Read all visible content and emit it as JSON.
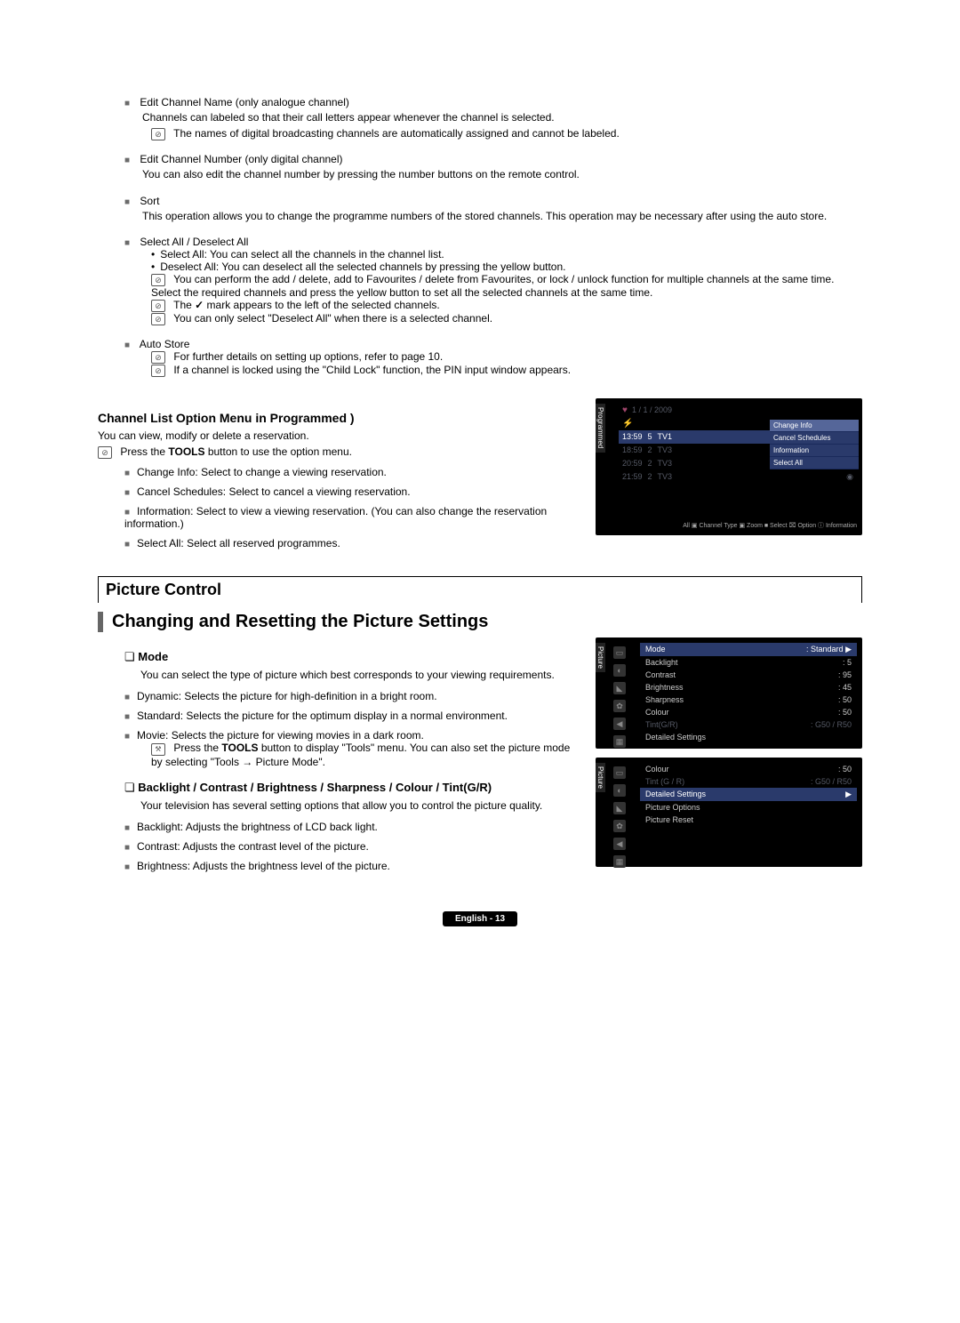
{
  "sections": {
    "editChannelName": {
      "title": "Edit Channel Name (only analogue channel)",
      "desc": "Channels can labeled so that their call letters appear whenever the channel is selected.",
      "note": "The names of digital broadcasting channels are automatically assigned and cannot be labeled."
    },
    "editChannelNumber": {
      "title": "Edit Channel Number (only digital channel)",
      "desc": "You can also edit the channel number by pressing the number buttons on the remote control."
    },
    "sort": {
      "title": "Sort",
      "desc": "This operation allows you to change the programme numbers of the stored channels. This operation may be necessary after using the auto store."
    },
    "selectAll": {
      "title": "Select All / Deselect All",
      "b1": "Select All: You can select all the channels in the channel list.",
      "b2": "Deselect All: You can deselect all the selected channels by pressing the yellow button.",
      "n1": "You can perform the add / delete, add to Favourites / delete from Favourites, or lock / unlock function for multiple channels at the same time. Select the required channels and press the yellow button to set all the selected channels at the same time.",
      "n2a": "The ",
      "n2b": " mark appears to the left of the selected channels.",
      "n3": "You can only select \"Deselect All\" when there is a selected channel."
    },
    "autoStore": {
      "title": "Auto Store",
      "n1": "For further details on setting up options, refer to page 10.",
      "n2": "If a channel is locked using the \"Child Lock\" function, the PIN input window appears."
    },
    "programmed": {
      "heading": "Channel List Option Menu in Programmed )",
      "desc": "You can view, modify or delete a reservation.",
      "note_pre": "Press the ",
      "note_bold": "TOOLS",
      "note_post": " button to use the option menu.",
      "b1": "Change Info: Select to change a viewing reservation.",
      "b2": "Cancel Schedules: Select to cancel a viewing reservation.",
      "b3": "Information: Select to view a viewing reservation. (You can also change the reservation information.)",
      "b4": "Select All: Select all reserved programmes."
    },
    "pictureBand": "Picture Control",
    "pictureTitle": "Changing and Resetting the Picture Settings",
    "mode": {
      "title": "Mode",
      "desc": "You can select the type of picture which best corresponds to your viewing requirements.",
      "b1": "Dynamic: Selects the picture for high-definition in a bright room.",
      "b2": "Standard: Selects the picture for the optimum display in a normal environment.",
      "b3": "Movie: Selects the picture for viewing movies in a dark room.",
      "tool_pre": "Press the ",
      "tool_bold": "TOOLS",
      "tool_post": " button to display \"Tools\" menu. You can also set the picture mode by selecting \"Tools → Picture Mode\"."
    },
    "backlight": {
      "title": "Backlight / Contrast / Brightness / Sharpness / Colour / Tint(G/R)",
      "desc": "Your television has several setting options that allow you to control the picture quality.",
      "b1": "Backlight: Adjusts the brightness of LCD back light.",
      "b2": "Contrast: Adjusts the contrast level of the picture.",
      "b3": "Brightness: Adjusts the brightness level of the picture."
    }
  },
  "osd1": {
    "tab": "Programmed",
    "date": "1 / 1 / 2009",
    "rows": [
      {
        "time": "13:59",
        "ch": "5",
        "name": "TV1"
      },
      {
        "time": "18:59",
        "ch": "2",
        "name": "TV3"
      },
      {
        "time": "20:59",
        "ch": "2",
        "name": "TV3"
      },
      {
        "time": "21:59",
        "ch": "2",
        "name": "TV3"
      }
    ],
    "menu": [
      "Change Info",
      "Cancel Schedules",
      "Information",
      "Select All"
    ],
    "footer": "All  ▣ Channel Type  ▣ Zoom  ■ Select  ⌧ Option  ⓘ Information"
  },
  "osd2": {
    "tab": "Picture",
    "rows": [
      {
        "k": "Mode",
        "v": ": Standard",
        "head": true
      },
      {
        "k": "Backlight",
        "v": ": 5"
      },
      {
        "k": "Contrast",
        "v": ": 95"
      },
      {
        "k": "Brightness",
        "v": ": 45"
      },
      {
        "k": "Sharpness",
        "v": ": 50"
      },
      {
        "k": "Colour",
        "v": ": 50"
      },
      {
        "k": "Tint(G/R)",
        "v": ": G50 / R50",
        "dim": true
      },
      {
        "k": "Detailed Settings",
        "v": ""
      }
    ]
  },
  "osd3": {
    "tab": "Picture",
    "rows": [
      {
        "k": "Colour",
        "v": ": 50"
      },
      {
        "k": "Tint (G / R)",
        "v": ": G50 / R50",
        "dim": true
      },
      {
        "k": "Detailed Settings",
        "v": "",
        "head": true
      },
      {
        "k": "Picture Options",
        "v": ""
      },
      {
        "k": "Picture Reset",
        "v": ""
      }
    ]
  },
  "footer": "English - 13"
}
